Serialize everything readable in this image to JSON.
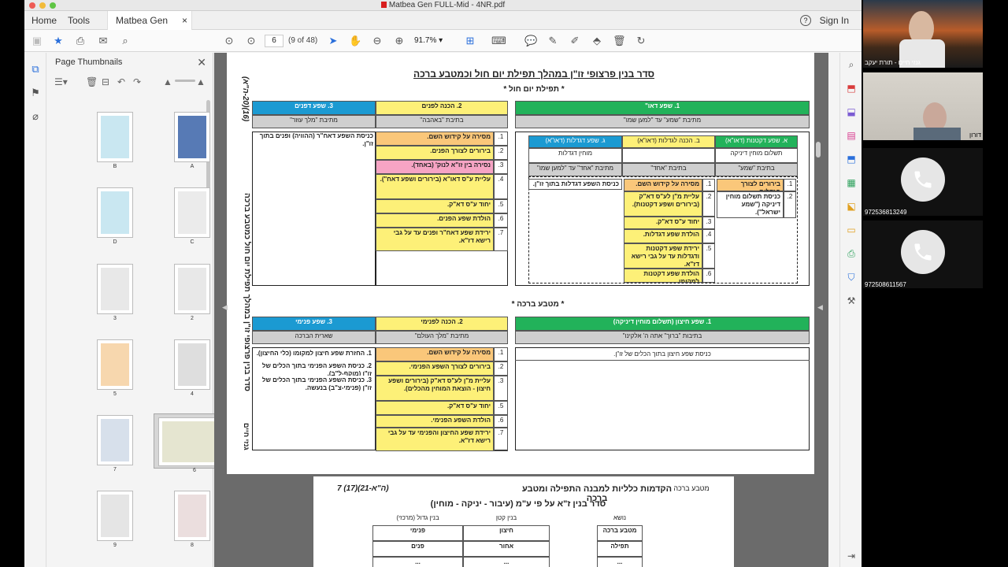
{
  "window": {
    "title": "Matbea Gen FULL-Mid - 4NR.pdf"
  },
  "tabs": {
    "home": "Home",
    "tools": "Tools",
    "doc": "Matbea Gen FULL...",
    "close": "×"
  },
  "header": {
    "help": "?",
    "signin": "Sign In"
  },
  "toolbar": {
    "page": "6",
    "page_of": "(9 of 48)",
    "zoom": "91.7%"
  },
  "thumbs": {
    "title": "Page Thumbnails",
    "close": "✕",
    "labels": [
      "B",
      "A",
      "D",
      "C",
      "3",
      "2",
      "5",
      "4",
      "7",
      "6",
      "9",
      "8"
    ]
  },
  "page6": {
    "title": "סדר בנין פרצופי זו\"ן במהלך תפילת יום חול וכמטבע ברכה",
    "section1": "* תפילת יום חול *",
    "section2": "* מטבע ברכה *",
    "side_number": "(16)(20-ה\"א)",
    "side_text": "סדר בנין פרצופי זו\"ן במהלך תפילת יום חול כמטבע ברכה",
    "side_text2": "גנזי חיים",
    "t1": {
      "h_left": "1. שפע דאו\"",
      "h_mid": "2. הכנה לפנים",
      "h_right": "3. שפע דפנים",
      "sub_left": "מתיבת \"שמע\" עד \"למען שמו\"",
      "sub_mid": "בתיבת \"באהבה\"",
      "sub_right": "מתיבת \"מלך עוזר\"",
      "right_col": "כניסת השפע דאח\"ר (ההוויה) ופנים בתוך זו\"ן.",
      "mid_rows": [
        {
          "n": "1.",
          "t": "מסירה על קידוש השם."
        },
        {
          "n": "2.",
          "t": "בירורים לצורך הפנים."
        },
        {
          "n": "3.",
          "t": "נסירה בין זו\"א לנוק' (באחד)."
        },
        {
          "n": "4.",
          "t": "עליית ע\"ס דאו\"א (בירורים ושפע דאח\")."
        },
        {
          "n": "5.",
          "t": "יחוד ע\"ס דא\"ק."
        },
        {
          "n": "6.",
          "t": "הולדת שפע הפנים."
        },
        {
          "n": "7.",
          "t": "ירידת שפע דאח\"ר ופנים עד על גבי רישא דז\"א."
        }
      ],
      "sub_a": "א. שפע דקטנות (דאו\"א)",
      "sub_b": "ב. הכנה לגדלות (דאו\"א)",
      "sub_c": "ג. שפע דגדלות (דאו\"א)",
      "a_1": "תשלום מוחין דיניקה",
      "a_2": "בתיבת \"שמע\"",
      "b_2": "בתיבת \"אחד\"",
      "c_1": "מוחין דגדלות",
      "c_2": "מתיבת \"אחד\" עד \"למען שמו\"",
      "a_rows": [
        {
          "n": "1.",
          "t": "בירורים לצורך הגדלות."
        },
        {
          "n": "2.",
          "t": "כניסת תשלום מוחין דיניקה (\"שמע ישראל\")."
        }
      ],
      "b_rows": [
        {
          "n": "1.",
          "t": "מסירה על קידוש השם."
        },
        {
          "n": "2.",
          "t": "עליית מ\"ן לע\"ס דא\"ק (בירורים ושפע דקטנות)."
        },
        {
          "n": "3.",
          "t": "יחוד ע\"ס דא\"ק."
        },
        {
          "n": "4.",
          "t": "הולדת שפע דגדלות."
        },
        {
          "n": "5.",
          "t": "ירידת שפע דקטנות ודגדלות עד על גבי רישא דז\"א."
        },
        {
          "n": "6.",
          "t": "הולדת שפע דקטנות למקומו."
        }
      ],
      "c_row": "כניסת השפע דגדלות בתוך זו\"ן."
    },
    "t2": {
      "h_left": "1. שפע חיצון (תשלום מוחין דיניקה)",
      "h_mid": "2. הכנה לפנימי",
      "h_right": "3. שפע פנימי",
      "sub_left": "בתיבות \"ברוך\" אתה ה' אלקינו\"",
      "sub_mid": "מתיבת \"מלך העולם\"",
      "sub_right": "שארית הברכה",
      "left_text": "כניסת שפע חיצון בתוך הכלים של זו\"ן.",
      "right_rows": [
        "1. החזרת שפע חיצון למקומו (כלי החיצון).",
        "2. כניסת השפע הפנימי בתוך הכלים של זו\"ן (מוקף-ל\"ב).",
        "3. כניסת השפע הפנימי בתוך הכלים של זו\"ן (פנימי-צ\"ב) בנעשה."
      ],
      "mid_rows": [
        {
          "n": "1.",
          "t": "מסירה על קידוש השם."
        },
        {
          "n": "2.",
          "t": "בירורים לצורך השפע הפנימי."
        },
        {
          "n": "3.",
          "t": "עליית מ\"ן לע\"ס דא\"ק (בירורים ושפע חיצון - הוצאת המוחין מהכלים)."
        },
        {
          "n": "5.",
          "t": "יחוד ע\"ס דא\"ק."
        },
        {
          "n": "6.",
          "t": "הולדת השפע הפנימי."
        },
        {
          "n": "7.",
          "t": "ירידת שפע החיצון והפנימי עד על גבי רישא דז\"א."
        }
      ]
    }
  },
  "page7": {
    "title": "הקדמות כלליות למבנה התפילה ומטבע ברכה",
    "number": "7  (17)(21-ה\"א)",
    "corner": "מטבע ברכה",
    "subtitle": "סדר בנין ז\"א על פי ע\"מ (עיבור - יניקה - מוחין)",
    "cols": [
      "נושא",
      "בנין קטן",
      "בנין גדול (מרכזי)"
    ],
    "rows": [
      [
        "מטבע ברכה",
        "חיצון",
        "פנימי"
      ],
      [
        "תפילה",
        "אחור",
        "פנים"
      ],
      [
        "...",
        "...",
        "..."
      ]
    ]
  },
  "zoom": {
    "tile1_name": "גנזי חיים - תורת יעקב",
    "tile2_name": "דורון",
    "call1": "972536813249",
    "call2": "972508611567"
  },
  "colors": {
    "green": "#22b25a",
    "blue": "#1b9ad2",
    "yellow": "#fdf078",
    "orange": "#fac77a",
    "pink": "#f6a4c4"
  }
}
